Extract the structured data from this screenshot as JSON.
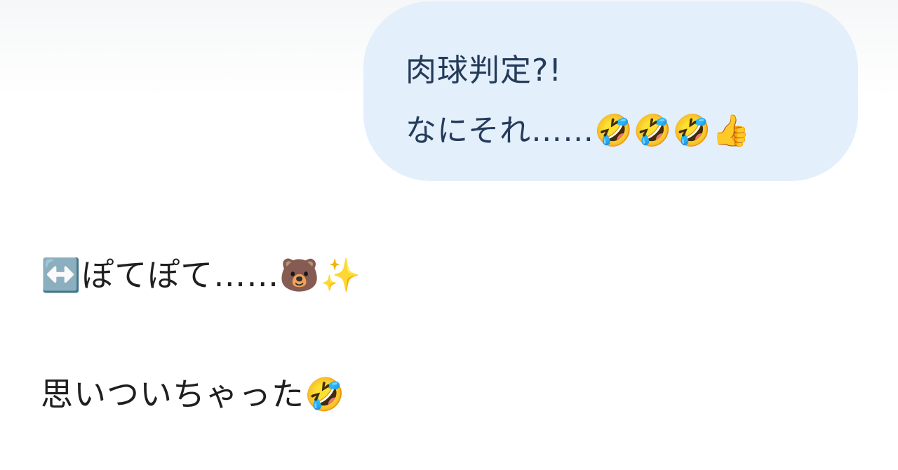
{
  "messages": [
    {
      "side": "sent",
      "lines": [
        "肉球判定?!",
        "なにそれ……🤣🤣🤣👍"
      ]
    },
    {
      "side": "received",
      "lines": [
        "↔️ぽてぽて……🐻✨",
        "思いついちゃった🤣"
      ]
    }
  ],
  "colors": {
    "sent_bubble": "#e3effb",
    "sent_text": "#243b5a",
    "received_text": "#1f1f1f"
  }
}
